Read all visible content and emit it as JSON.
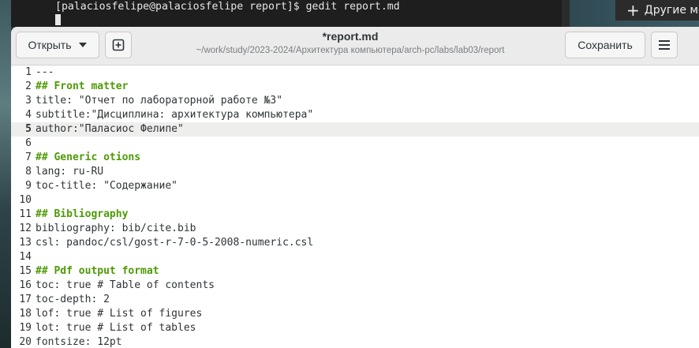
{
  "terminal": {
    "prompt": "[palaciosfelipe@palaciosfelipe report]$ gedit report.md"
  },
  "side_window": {
    "button_label": "Другие ме"
  },
  "gedit": {
    "open_label": "Открыть",
    "save_label": "Сохранить",
    "title": "*report.md",
    "path": "~/work/study/2023-2024/Архитектура компьютера/arch-pc/labs/lab03/report",
    "current_line": 5,
    "lines": [
      {
        "num": "1",
        "text": "---"
      },
      {
        "num": "2",
        "text": "## Front matter"
      },
      {
        "num": "3",
        "text": "title: \"Отчет по лабораторной работе №3\""
      },
      {
        "num": "4",
        "text": "subtitle:\"Дисциплина: архитектура компьютера\""
      },
      {
        "num": "5",
        "text": "author:\"Паласиос Фелипе\""
      },
      {
        "num": "6",
        "text": ""
      },
      {
        "num": "7",
        "text": "## Generic otions"
      },
      {
        "num": "8",
        "text": "lang: ru-RU"
      },
      {
        "num": "9",
        "text": "toc-title: \"Содержание\""
      },
      {
        "num": "10",
        "text": ""
      },
      {
        "num": "11",
        "text": "## Bibliography"
      },
      {
        "num": "12",
        "text": "bibliography: bib/cite.bib"
      },
      {
        "num": "13",
        "text": "csl: pandoc/csl/gost-r-7-0-5-2008-numeric.csl"
      },
      {
        "num": "14",
        "text": ""
      },
      {
        "num": "15",
        "text": "## Pdf output format"
      },
      {
        "num": "16",
        "text": "toc: true # Table of contents"
      },
      {
        "num": "17",
        "text": "toc-depth: 2"
      },
      {
        "num": "18",
        "text": "lof: true # List of figures"
      },
      {
        "num": "19",
        "text": "lot: true # List of tables"
      },
      {
        "num": "20",
        "text": "fontsize: 12pt"
      }
    ]
  }
}
